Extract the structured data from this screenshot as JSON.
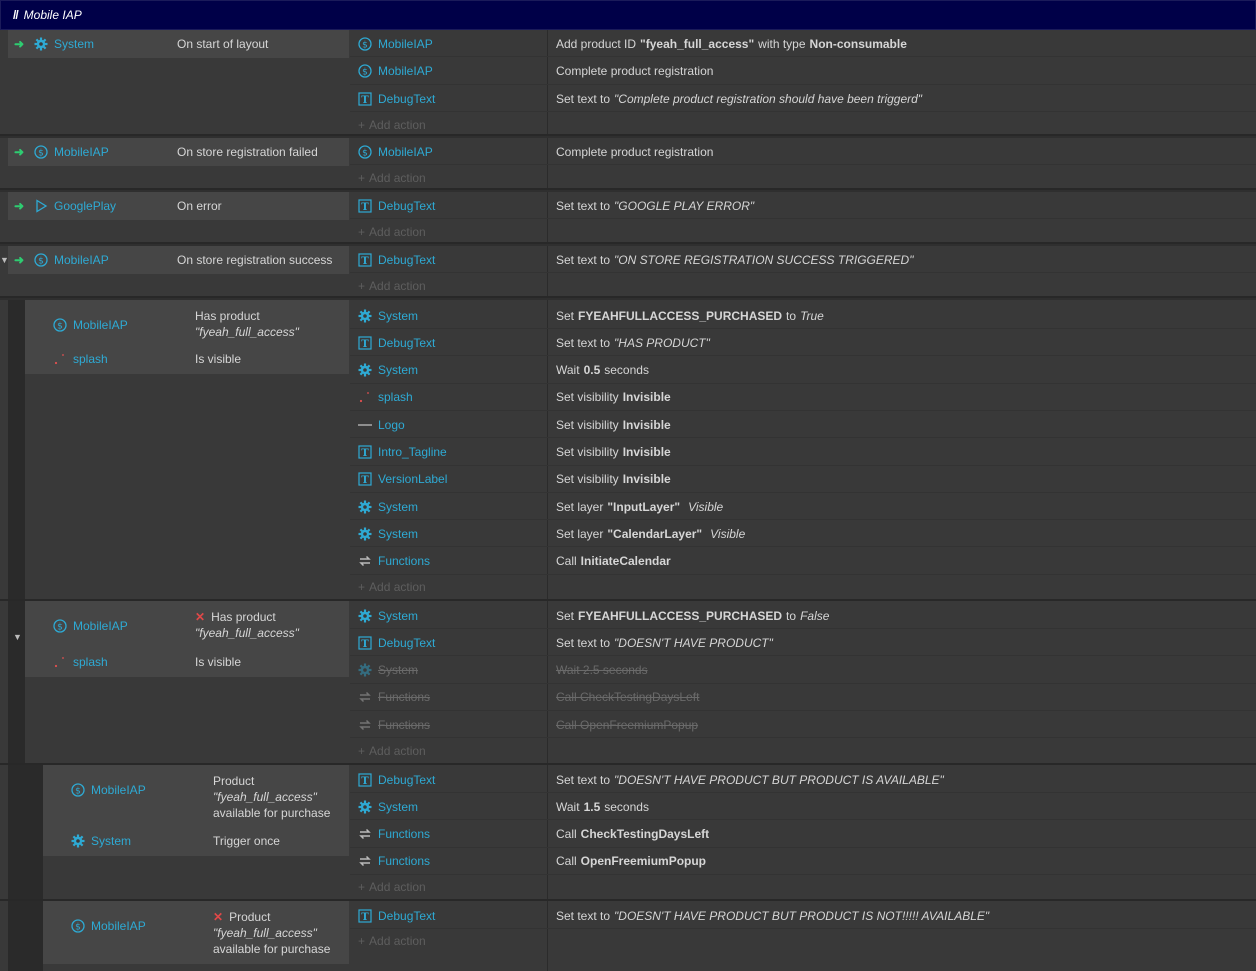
{
  "group": {
    "prefix": "//",
    "title": "Mobile IAP"
  },
  "add_action": "Add action",
  "events": [
    {
      "trigger": "➜",
      "obj": "System",
      "cond": "On start of layout",
      "actions": [
        {
          "obj": "MobileIAP",
          "a": "Add product ID",
          "b": "\"fyeah_full_access\"",
          "c": "with type",
          "d": "Non-consumable"
        },
        {
          "obj": "MobileIAP",
          "a": "Complete product registration"
        },
        {
          "obj": "DebugText",
          "a": "Set text to",
          "i": "\"Complete product registration should have been triggerd\""
        }
      ]
    },
    {
      "trigger": "➜",
      "obj": "MobileIAP",
      "cond": "On store registration failed",
      "actions": [
        {
          "obj": "MobileIAP",
          "a": "Complete product registration"
        }
      ]
    },
    {
      "trigger": "➜",
      "obj": "GooglePlay",
      "cond": "On error",
      "actions": [
        {
          "obj": "DebugText",
          "a": "Set text to",
          "i": "\"GOOGLE PLAY ERROR\""
        }
      ]
    },
    {
      "trigger": "➜",
      "obj": "MobileIAP",
      "cond": "On store registration success",
      "actions": [
        {
          "obj": "DebugText",
          "a": "Set text to",
          "i": "\"ON STORE REGISTRATION SUCCESS TRIGGERED\""
        }
      ]
    }
  ],
  "sub1": {
    "c1_obj": "MobileIAP",
    "c1_text": "Has product",
    "c1_param": "\"fyeah_full_access\"",
    "c2_obj": "splash",
    "c2_text": "Is visible",
    "actions": [
      {
        "obj": "System",
        "a": "Set",
        "b": "FYEAHFULLACCESS_PURCHASED",
        "c": "to",
        "i": "True"
      },
      {
        "obj": "DebugText",
        "a": "Set text to",
        "i": "\"HAS PRODUCT\""
      },
      {
        "obj": "System",
        "a": "Wait",
        "b": "0.5",
        "c": "seconds"
      },
      {
        "obj": "splash",
        "a": "Set visibility",
        "b": "Invisible"
      },
      {
        "obj": "Logo",
        "a": "Set visibility",
        "b": "Invisible"
      },
      {
        "obj": "Intro_Tagline",
        "a": "Set visibility",
        "b": "Invisible"
      },
      {
        "obj": "VersionLabel",
        "a": "Set visibility",
        "b": "Invisible"
      },
      {
        "obj": "System",
        "a": "Set layer",
        "b": "\"InputLayer\"",
        "i": "Visible"
      },
      {
        "obj": "System",
        "a": "Set layer",
        "b": "\"CalendarLayer\"",
        "i": "Visible"
      },
      {
        "obj": "Functions",
        "a": "Call",
        "b": "InitiateCalendar"
      }
    ]
  },
  "sub2": {
    "c1_obj": "MobileIAP",
    "c1_x": "✕",
    "c1_text": "Has product",
    "c1_param": "\"fyeah_full_access\"",
    "c2_obj": "splash",
    "c2_text": "Is visible",
    "actions": [
      {
        "obj": "System",
        "a": "Set",
        "b": "FYEAHFULLACCESS_PURCHASED",
        "c": "to",
        "i": "False"
      },
      {
        "obj": "DebugText",
        "a": "Set text to",
        "i": "\"DOESN'T HAVE PRODUCT\""
      },
      {
        "obj": "System",
        "a": "Wait 2.5 seconds"
      },
      {
        "obj": "Functions",
        "a": "Call CheckTestingDaysLeft"
      },
      {
        "obj": "Functions",
        "a": "Call OpenFreemiumPopup"
      }
    ]
  },
  "sub3": {
    "c1_obj": "MobileIAP",
    "c1_text": "Product",
    "c1_param": "\"fyeah_full_access\"",
    "c1_tail": "available for purchase",
    "c2_obj": "System",
    "c2_text": "Trigger once",
    "actions": [
      {
        "obj": "DebugText",
        "a": "Set text to",
        "i": "\"DOESN'T HAVE PRODUCT BUT PRODUCT IS AVAILABLE\""
      },
      {
        "obj": "System",
        "a": "Wait",
        "b": "1.5",
        "c": "seconds"
      },
      {
        "obj": "Functions",
        "a": "Call",
        "b": "CheckTestingDaysLeft"
      },
      {
        "obj": "Functions",
        "a": "Call",
        "b": "OpenFreemiumPopup"
      }
    ]
  },
  "sub4": {
    "c1_obj": "MobileIAP",
    "c1_x": "✕",
    "c1_text": "Product",
    "c1_param": "\"fyeah_full_access\"",
    "c1_tail": "available for purchase",
    "actions": [
      {
        "obj": "DebugText",
        "a": "Set text to",
        "i": "\"DOESN'T HAVE PRODUCT BUT PRODUCT IS NOT!!!!! AVAILABLE\""
      }
    ]
  },
  "colors": {
    "accent": "#2eaad4",
    "group_bg": "#000048",
    "trigger": "#2ecc71",
    "invert": "#e04848"
  }
}
